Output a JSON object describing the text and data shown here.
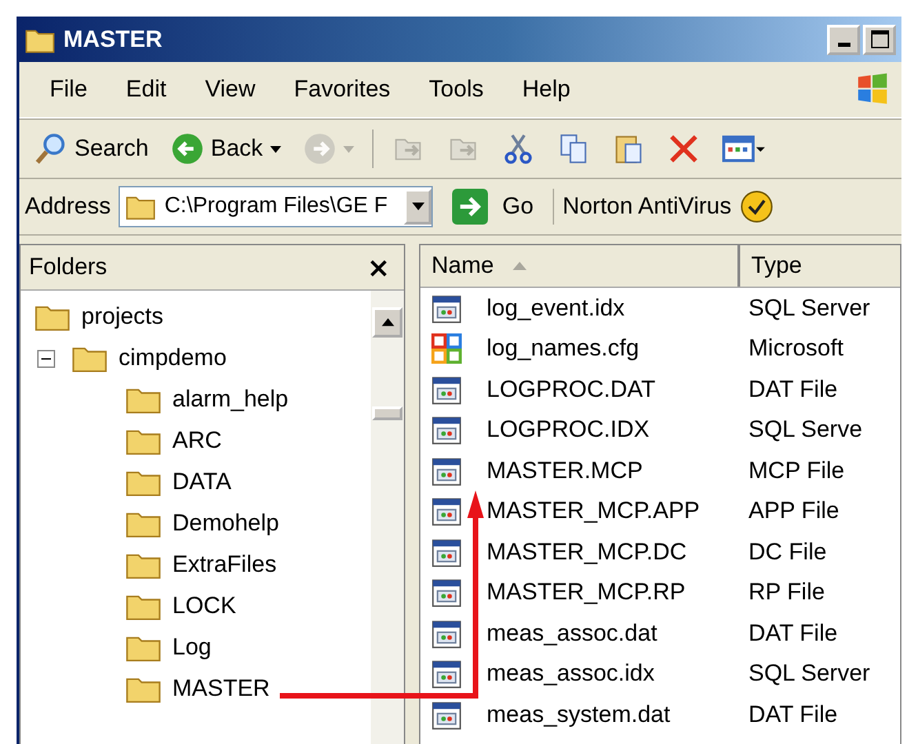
{
  "window": {
    "title": "MASTER"
  },
  "menu": [
    "File",
    "Edit",
    "View",
    "Favorites",
    "Tools",
    "Help"
  ],
  "toolbar": [
    {
      "kind": "search",
      "label": "Search",
      "disabled": false
    },
    {
      "kind": "back",
      "label": "Back",
      "disabled": false
    },
    {
      "kind": "forward",
      "disabled": true
    },
    {
      "kind": "move",
      "disabled": true
    },
    {
      "kind": "copyto",
      "disabled": true
    },
    {
      "kind": "cut",
      "disabled": false
    },
    {
      "kind": "copy",
      "disabled": false
    },
    {
      "kind": "paste",
      "disabled": false
    },
    {
      "kind": "delete",
      "disabled": false
    },
    {
      "kind": "views",
      "disabled": false
    }
  ],
  "address": {
    "label": "Address",
    "value": "C:\\Program Files\\GE F",
    "go": "Go",
    "extra": "Norton AntiVirus"
  },
  "folders": {
    "title": "Folders",
    "close": "×",
    "tree": [
      {
        "name": "projects",
        "children": [
          {
            "name": "cimpdemo",
            "expanded": true,
            "children": [
              {
                "name": "alarm_help"
              },
              {
                "name": "ARC"
              },
              {
                "name": "DATA"
              },
              {
                "name": "Demohelp"
              },
              {
                "name": "ExtraFiles"
              },
              {
                "name": "LOCK"
              },
              {
                "name": "Log"
              },
              {
                "name": "MASTER"
              }
            ]
          }
        ]
      }
    ]
  },
  "files": {
    "columns": [
      {
        "label": "Name",
        "sorted": true
      },
      {
        "label": "Type",
        "sorted": false
      }
    ],
    "rows": [
      {
        "kind": "data",
        "name": "log_event.idx",
        "type": "SQL Server"
      },
      {
        "kind": "config",
        "name": "log_names.cfg",
        "type": "Microsoft"
      },
      {
        "kind": "data",
        "name": "LOGPROC.DAT",
        "type": "DAT File"
      },
      {
        "kind": "data",
        "name": "LOGPROC.IDX",
        "type": "SQL Serve"
      },
      {
        "kind": "data",
        "name": "MASTER.MCP",
        "type": "MCP File"
      },
      {
        "kind": "data",
        "name": "MASTER_MCP.APP",
        "type": "APP File"
      },
      {
        "kind": "data",
        "name": "MASTER_MCP.DC",
        "type": "DC File"
      },
      {
        "kind": "data",
        "name": "MASTER_MCP.RP",
        "type": "RP File"
      },
      {
        "kind": "data",
        "name": "meas_assoc.dat",
        "type": "DAT File"
      },
      {
        "kind": "data",
        "name": "meas_assoc.idx",
        "type": "SQL Server"
      },
      {
        "kind": "data",
        "name": "meas_system.dat",
        "type": "DAT File"
      }
    ]
  }
}
